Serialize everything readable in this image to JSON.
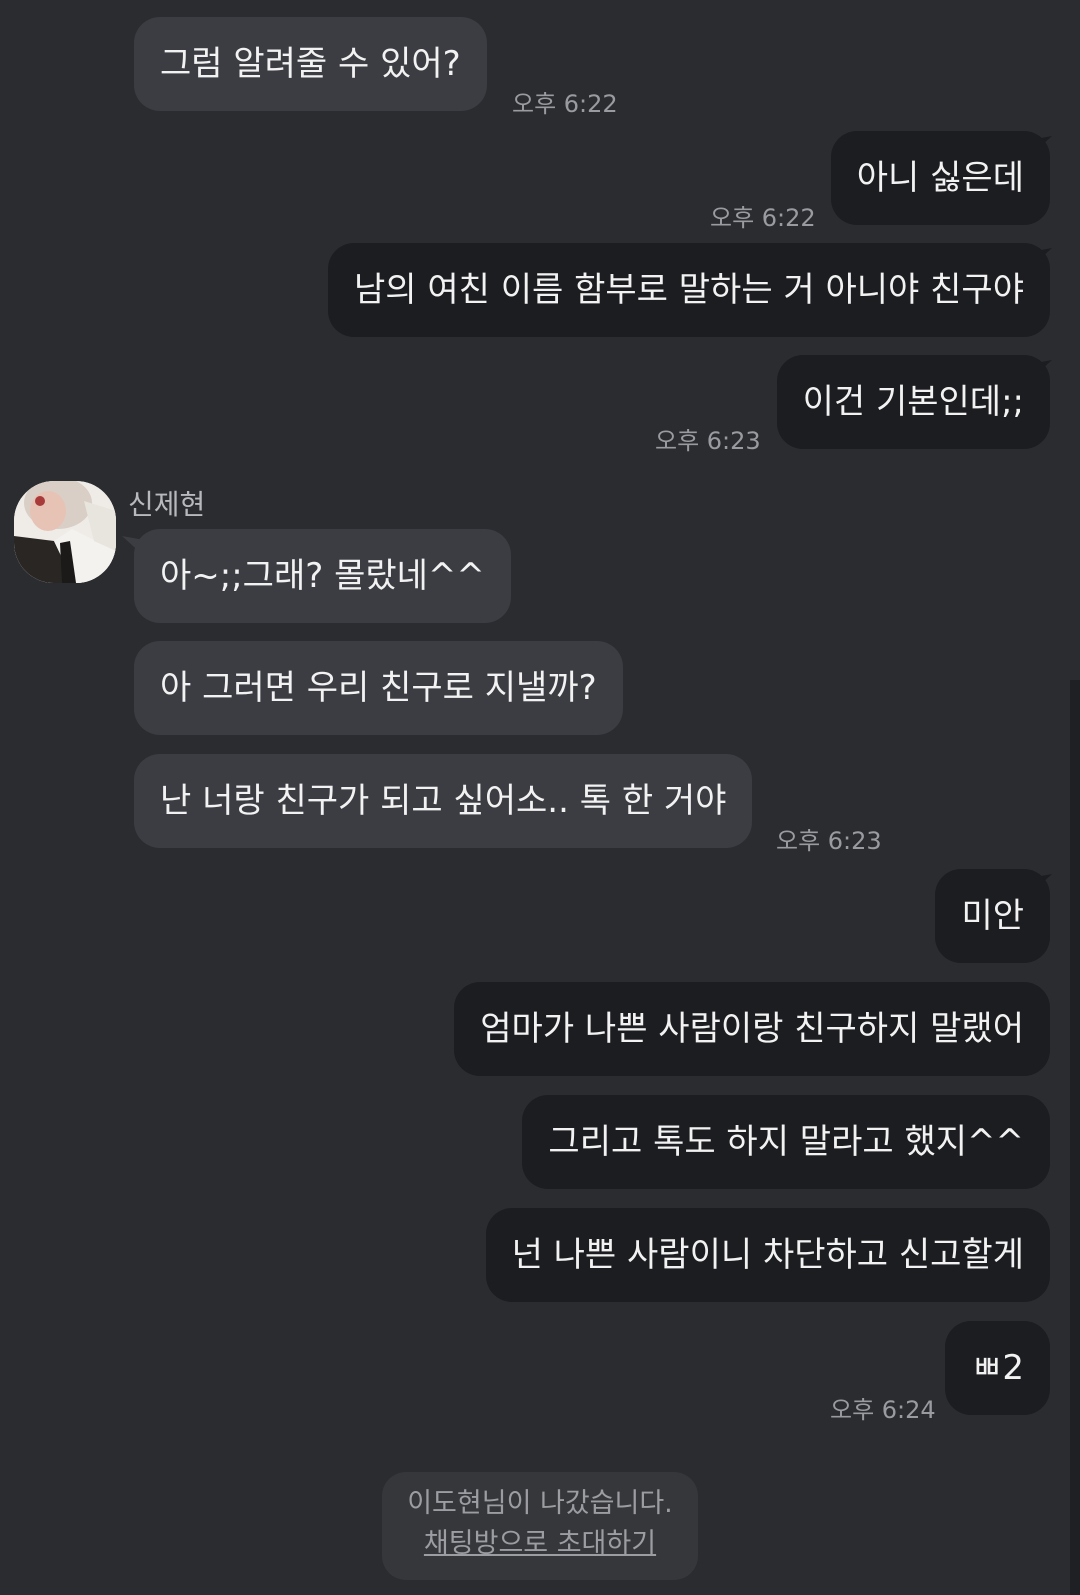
{
  "chat": {
    "messages": [
      {
        "side": "in",
        "text": "그럼 알려줄 수 있어?",
        "time": "오후 6:22"
      },
      {
        "side": "out",
        "text": "아니 싫은데",
        "time": "오후 6:22"
      },
      {
        "side": "out",
        "text": "남의 여친 이름 함부로 말하는 거 아니야 친구야"
      },
      {
        "side": "out",
        "text": "이건 기본인데;;",
        "time": "오후 6:23"
      },
      {
        "side": "in",
        "sender": "신제현",
        "text": "아~;;그래? 몰랐네^^"
      },
      {
        "side": "in",
        "text": "아 그러면 우리 친구로 지낼까?"
      },
      {
        "side": "in",
        "text": "난 너랑 친구가 되고 싶어소.. 톡 한 거야",
        "time": "오후 6:23"
      },
      {
        "side": "out",
        "text": "미안"
      },
      {
        "side": "out",
        "text": "엄마가 나쁜 사람이랑 친구하지 말랬어"
      },
      {
        "side": "out",
        "text": "그리고 톡도 하지 말라고 했지^^"
      },
      {
        "side": "out",
        "text": "넌 나쁜 사람이니 차단하고 신고할게"
      },
      {
        "side": "out",
        "text": "ㅃ2",
        "time": "오후 6:24"
      }
    ]
  },
  "notice": {
    "left_text": "이도현님이 나갔습니다.",
    "invite_link": "채팅방으로 초대하기"
  }
}
